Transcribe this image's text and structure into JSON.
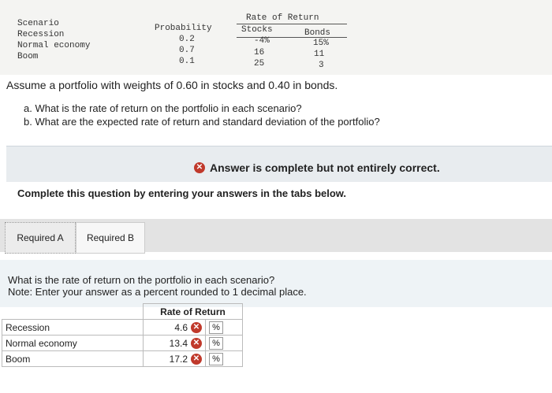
{
  "scenario_table": {
    "header_scenario": "Scenario",
    "header_probability": "Probability",
    "header_rate_of_return": "Rate of Return",
    "header_stocks": "Stocks",
    "header_bonds": "Bonds",
    "rows": [
      {
        "scenario": "Recession",
        "probability": "0.2",
        "stocks": "-4%",
        "bonds": "15%"
      },
      {
        "scenario": "Normal economy",
        "probability": "0.7",
        "stocks": "16",
        "bonds": "11"
      },
      {
        "scenario": "Boom",
        "probability": "0.1",
        "stocks": "25",
        "bonds": "3"
      }
    ]
  },
  "problem": {
    "statement": "Assume a portfolio with weights of 0.60 in stocks and 0.40 in bonds.",
    "part_a": "a. What is the rate of return on the portfolio in each scenario?",
    "part_b": "b. What are the expected rate of return and standard deviation of the portfolio?"
  },
  "banner": {
    "status_text": "Answer is complete but not entirely correct."
  },
  "instruction": "Complete this question by entering your answers in the tabs below.",
  "tabs": [
    {
      "label": "Required A"
    },
    {
      "label": "Required B"
    }
  ],
  "question": {
    "line1": "What is the rate of return on the portfolio in each scenario?",
    "line2": "Note: Enter your answer as a percent rounded to 1 decimal place."
  },
  "answer_table": {
    "header": "Rate of Return",
    "rows": [
      {
        "label": "Recession",
        "value": "4.6",
        "unit": "%"
      },
      {
        "label": "Normal economy",
        "value": "13.4",
        "unit": "%"
      },
      {
        "label": "Boom",
        "value": "17.2",
        "unit": "%"
      }
    ]
  }
}
